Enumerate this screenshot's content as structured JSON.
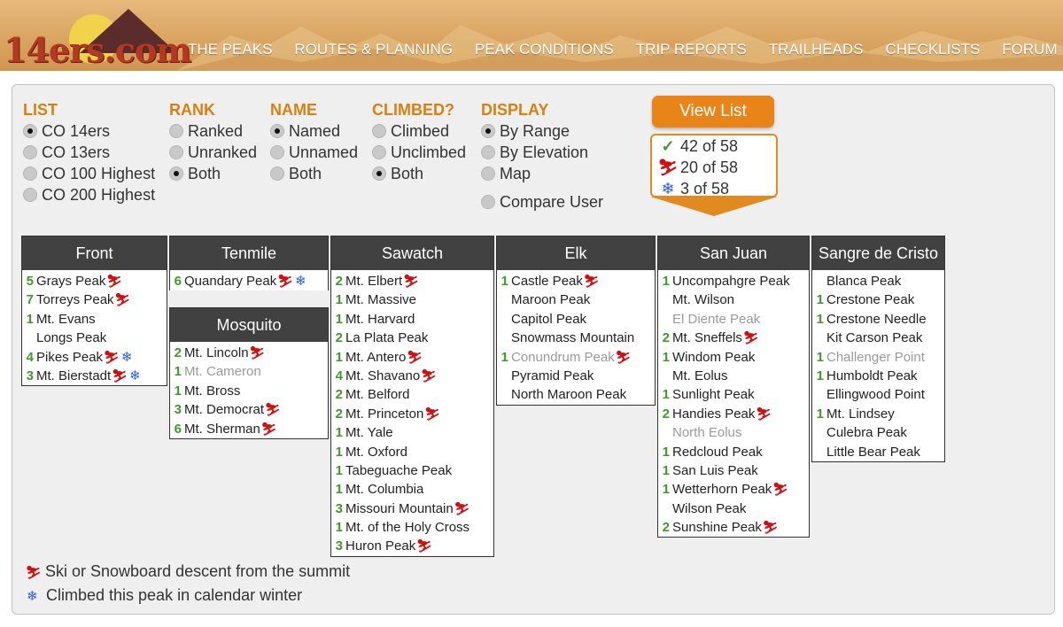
{
  "header": {
    "logo_text": "14ers.com",
    "nav": [
      "THE PEAKS",
      "ROUTES & PLANNING",
      "PEAK CONDITIONS",
      "TRIP REPORTS",
      "TRAILHEADS",
      "CHECKLISTS",
      "FORUM"
    ]
  },
  "filters": {
    "list": {
      "title": "LIST",
      "options": [
        "CO 14ers",
        "CO 13ers",
        "CO 100 Highest",
        "CO 200 Highest"
      ],
      "selected": 0
    },
    "rank": {
      "title": "RANK",
      "options": [
        "Ranked",
        "Unranked",
        "Both"
      ],
      "selected": 2
    },
    "name": {
      "title": "NAME",
      "options": [
        "Named",
        "Unnamed",
        "Both"
      ],
      "selected": 0
    },
    "climbed": {
      "title": "CLIMBED?",
      "options": [
        "Climbed",
        "Unclimbed",
        "Both"
      ],
      "selected": 2
    },
    "display": {
      "title": "DISPLAY",
      "options": [
        "By Range",
        "By Elevation",
        "Map"
      ],
      "selected": 0,
      "compare": "Compare User"
    }
  },
  "view_button": "View List",
  "stats": {
    "climbed": "42 of 58",
    "ski": "20 of 58",
    "winter": "3 of 58"
  },
  "icons": {
    "check": "check-icon",
    "ski": "ski-icon",
    "snow": "snowflake-icon"
  },
  "colors": {
    "accent": "#d88012",
    "button": "#e98418",
    "count": "#3f9a28",
    "ski": "#d01010",
    "snow": "#2a5be0",
    "range_header": "#414141"
  },
  "ranges": [
    {
      "name": "Front",
      "peaks": [
        {
          "count": "5",
          "name": "Grays Peak",
          "ski": true
        },
        {
          "count": "7",
          "name": "Torreys Peak",
          "ski": true
        },
        {
          "count": "1",
          "name": "Mt. Evans"
        },
        {
          "count": "",
          "name": "Longs Peak"
        },
        {
          "count": "4",
          "name": "Pikes Peak",
          "ski": true,
          "snow": true
        },
        {
          "count": "3",
          "name": "Mt. Bierstadt",
          "ski": true,
          "snow": true
        }
      ]
    },
    {
      "name": "Tenmile",
      "peaks": [
        {
          "count": "6",
          "name": "Quandary Peak",
          "ski": true,
          "snow": true
        }
      ]
    },
    {
      "name": "Mosquito",
      "peaks": [
        {
          "count": "2",
          "name": "Mt. Lincoln",
          "ski": true
        },
        {
          "count": "1",
          "name": "Mt. Cameron",
          "dim": true
        },
        {
          "count": "1",
          "name": "Mt. Bross"
        },
        {
          "count": "3",
          "name": "Mt. Democrat",
          "ski": true
        },
        {
          "count": "6",
          "name": "Mt. Sherman",
          "ski": true
        }
      ]
    },
    {
      "name": "Sawatch",
      "peaks": [
        {
          "count": "2",
          "name": "Mt. Elbert",
          "ski": true
        },
        {
          "count": "1",
          "name": "Mt. Massive"
        },
        {
          "count": "1",
          "name": "Mt. Harvard"
        },
        {
          "count": "2",
          "name": "La Plata Peak"
        },
        {
          "count": "1",
          "name": "Mt. Antero",
          "ski": true
        },
        {
          "count": "4",
          "name": "Mt. Shavano",
          "ski": true
        },
        {
          "count": "2",
          "name": "Mt. Belford"
        },
        {
          "count": "2",
          "name": "Mt. Princeton",
          "ski": true
        },
        {
          "count": "1",
          "name": "Mt. Yale"
        },
        {
          "count": "1",
          "name": "Mt. Oxford"
        },
        {
          "count": "1",
          "name": "Tabeguache Peak"
        },
        {
          "count": "1",
          "name": "Mt. Columbia"
        },
        {
          "count": "3",
          "name": "Missouri Mountain",
          "ski": true
        },
        {
          "count": "1",
          "name": "Mt. of the Holy Cross"
        },
        {
          "count": "3",
          "name": "Huron Peak",
          "ski": true
        }
      ]
    },
    {
      "name": "Elk",
      "peaks": [
        {
          "count": "1",
          "name": "Castle Peak",
          "ski": true
        },
        {
          "count": "",
          "name": "Maroon Peak"
        },
        {
          "count": "",
          "name": "Capitol Peak"
        },
        {
          "count": "",
          "name": "Snowmass Mountain"
        },
        {
          "count": "1",
          "name": "Conundrum Peak",
          "ski": true,
          "dim": true
        },
        {
          "count": "",
          "name": "Pyramid Peak"
        },
        {
          "count": "",
          "name": "North Maroon Peak"
        }
      ]
    },
    {
      "name": "San Juan",
      "peaks": [
        {
          "count": "1",
          "name": "Uncompahgre Peak"
        },
        {
          "count": "",
          "name": "Mt. Wilson"
        },
        {
          "count": "",
          "name": "El Diente Peak",
          "dim": true
        },
        {
          "count": "2",
          "name": "Mt. Sneffels",
          "ski": true
        },
        {
          "count": "1",
          "name": "Windom Peak"
        },
        {
          "count": "",
          "name": "Mt. Eolus"
        },
        {
          "count": "1",
          "name": "Sunlight Peak"
        },
        {
          "count": "2",
          "name": "Handies Peak",
          "ski": true
        },
        {
          "count": "",
          "name": "North Eolus",
          "dim": true
        },
        {
          "count": "1",
          "name": "Redcloud Peak"
        },
        {
          "count": "1",
          "name": "San Luis Peak"
        },
        {
          "count": "1",
          "name": "Wetterhorn Peak",
          "ski": true
        },
        {
          "count": "",
          "name": "Wilson Peak"
        },
        {
          "count": "2",
          "name": "Sunshine Peak",
          "ski": true
        }
      ]
    },
    {
      "name": "Sangre de Cristo",
      "peaks": [
        {
          "count": "",
          "name": "Blanca Peak"
        },
        {
          "count": "1",
          "name": "Crestone Peak"
        },
        {
          "count": "1",
          "name": "Crestone Needle"
        },
        {
          "count": "",
          "name": "Kit Carson Peak"
        },
        {
          "count": "1",
          "name": "Challenger Point",
          "dim": true
        },
        {
          "count": "1",
          "name": "Humboldt Peak"
        },
        {
          "count": "",
          "name": "Ellingwood Point"
        },
        {
          "count": "1",
          "name": "Mt. Lindsey"
        },
        {
          "count": "",
          "name": "Culebra Peak"
        },
        {
          "count": "",
          "name": "Little Bear Peak"
        }
      ]
    }
  ],
  "legend": {
    "ski": "Ski or Snowboard descent from the summit",
    "winter": "Climbed this peak in calendar winter"
  }
}
